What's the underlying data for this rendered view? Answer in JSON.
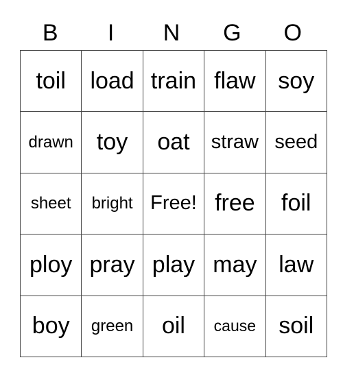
{
  "header": [
    "B",
    "I",
    "N",
    "G",
    "O"
  ],
  "rows": [
    [
      "toil",
      "load",
      "train",
      "flaw",
      "soy"
    ],
    [
      "drawn",
      "toy",
      "oat",
      "straw",
      "seed"
    ],
    [
      "sheet",
      "bright",
      "Free!",
      "free",
      "foil"
    ],
    [
      "ploy",
      "pray",
      "play",
      "may",
      "law"
    ],
    [
      "boy",
      "green",
      "oil",
      "cause",
      "soil"
    ]
  ]
}
